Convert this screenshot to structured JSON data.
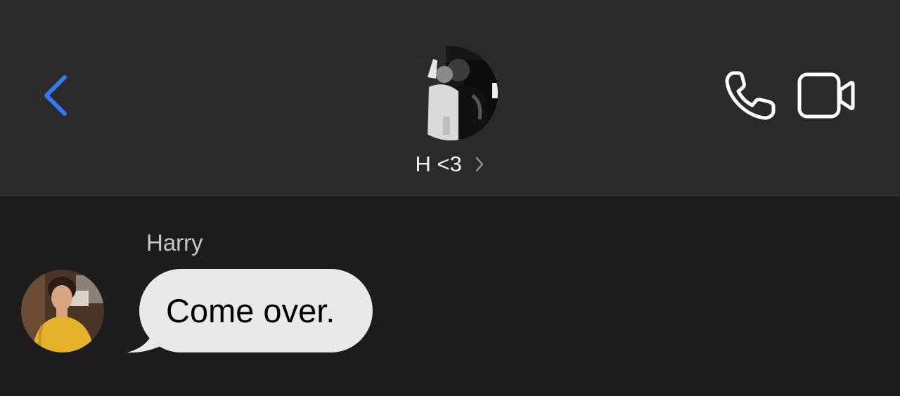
{
  "header": {
    "contact_name": "H <3",
    "back_icon": "chevron-left-icon",
    "call_icon": "phone-icon",
    "video_icon": "video-camera-icon",
    "accent_color": "#3478f6"
  },
  "messages": [
    {
      "sender": "Harry",
      "text": "Come over.",
      "direction": "incoming"
    }
  ],
  "colors": {
    "header_bg": "#2a2a2c",
    "chat_bg": "#1c1c1e",
    "incoming_bubble": "#e9e9eb"
  }
}
